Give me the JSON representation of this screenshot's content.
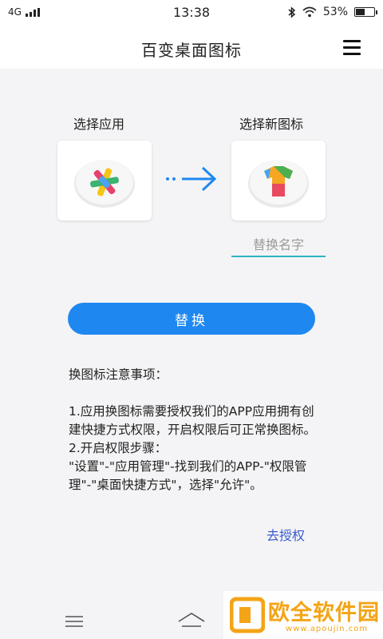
{
  "status_bar": {
    "network": "4G",
    "time": "13:38",
    "battery_percent": "53%",
    "battery_level": 0.53
  },
  "app_bar": {
    "title": "百变桌面图标",
    "menu_icon": "menu-icon"
  },
  "selection": {
    "select_app_label": "选择应用",
    "select_icon_label": "选择新图标",
    "app_icon": "colorful-asterisk-app-icon",
    "new_icon": "colorful-tshirt-icon",
    "arrow_icon": "arrow-right-icon"
  },
  "rename": {
    "placeholder": "替换名字",
    "value": ""
  },
  "replace_button": {
    "label": "替换"
  },
  "notes": {
    "heading": "换图标注意事项：",
    "line1": "1.应用换图标需要授权我们的APP应用拥有创建快捷方式权限，开启权限后可正常换图标。",
    "line2": "2.开启权限步骤：",
    "line3": "\"设置\"-\"应用管理\"-找到我们的APP-\"权限管理\"-\"桌面快捷方式\"，选择\"允许\"。"
  },
  "auth_link": {
    "label": "去授权"
  },
  "colors": {
    "accent_blue": "#1e88f0",
    "input_underline": "#2bb5bf",
    "link_blue": "#3a5bd0",
    "watermark_orange": "#f3a417"
  },
  "watermark": {
    "title": "欧全软件园",
    "url": "www.apoujin.com"
  }
}
